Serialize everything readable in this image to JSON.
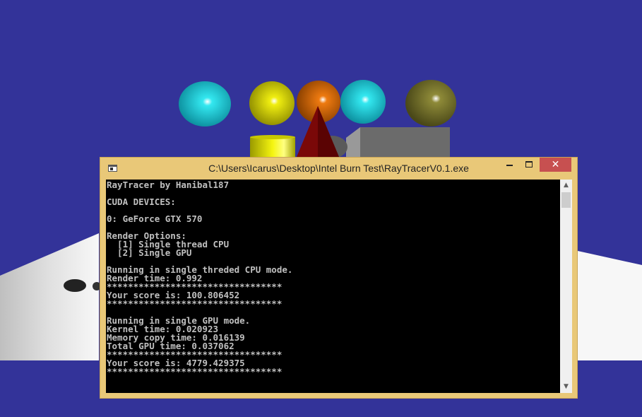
{
  "window": {
    "title": "C:\\Users\\Icarus\\Desktop\\Intel Burn Test\\RayTracerV0.1.exe",
    "close_glyph": "✕",
    "minimize_icon": "minimize-icon",
    "maximize_icon": "maximize-icon"
  },
  "console": {
    "lines": [
      "RayTracer by Hanibal187",
      "",
      "CUDA DEVICES:",
      "",
      "0: GeForce GTX 570",
      "",
      "Render Options:",
      "  [1] Single thread CPU",
      "  [2] Single GPU",
      "",
      "Running in single threded CPU mode.",
      "Render time: 0.992",
      "*********************************",
      "Your score is: 100.806452",
      "*********************************",
      "",
      "Running in single GPU mode.",
      "Kernel time: 0.020923",
      "Memory copy time: 0.016139",
      "Total GPU time: 0.037062",
      "*********************************",
      "Your score is: 4779.429375",
      "*********************************"
    ]
  },
  "colors": {
    "background": "#333399",
    "window_frame": "#e9c878",
    "close_button": "#c75050",
    "console_bg": "#000000",
    "console_text": "#c0c0c0"
  }
}
